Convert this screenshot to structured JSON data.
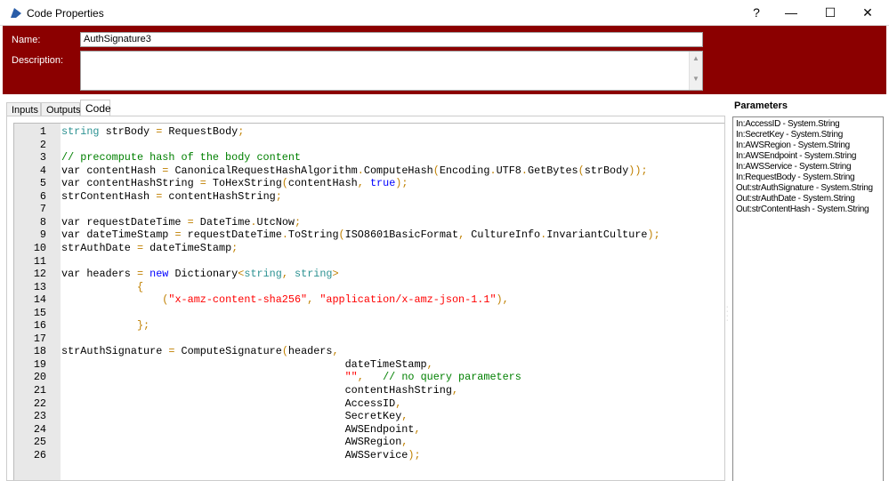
{
  "window": {
    "title": "Code Properties",
    "help": "?",
    "minimize": "—",
    "maximize": "☐",
    "close": "✕"
  },
  "form": {
    "name_label": "Name:",
    "name_value": "AuthSignature3",
    "description_label": "Description:",
    "description_value": ""
  },
  "tabs": [
    {
      "label": "Inputs"
    },
    {
      "label": "Outputs"
    },
    {
      "label": "Code"
    }
  ],
  "code_lines": [
    [
      [
        "type",
        "string"
      ],
      [
        "id",
        " strBody "
      ],
      [
        "op",
        "="
      ],
      [
        "id",
        " RequestBody"
      ],
      [
        "op",
        ";"
      ]
    ],
    [],
    [
      [
        "cm",
        "// precompute hash of the body content"
      ]
    ],
    [
      [
        "id",
        "var contentHash "
      ],
      [
        "op",
        "="
      ],
      [
        "id",
        " CanonicalRequestHashAlgorithm"
      ],
      [
        "op",
        "."
      ],
      [
        "id",
        "ComputeHash"
      ],
      [
        "op",
        "("
      ],
      [
        "id",
        "Encoding"
      ],
      [
        "op",
        "."
      ],
      [
        "id",
        "UTF8"
      ],
      [
        "op",
        "."
      ],
      [
        "id",
        "GetBytes"
      ],
      [
        "op",
        "("
      ],
      [
        "id",
        "strBody"
      ],
      [
        "op",
        "));"
      ]
    ],
    [
      [
        "id",
        "var contentHashString "
      ],
      [
        "op",
        "="
      ],
      [
        "id",
        " ToHexString"
      ],
      [
        "op",
        "("
      ],
      [
        "id",
        "contentHash"
      ],
      [
        "op",
        ","
      ],
      [
        "id",
        " "
      ],
      [
        "kw",
        "true"
      ],
      [
        "op",
        ");"
      ]
    ],
    [
      [
        "id",
        "strContentHash "
      ],
      [
        "op",
        "="
      ],
      [
        "id",
        " contentHashString"
      ],
      [
        "op",
        ";"
      ]
    ],
    [],
    [
      [
        "id",
        "var requestDateTime "
      ],
      [
        "op",
        "="
      ],
      [
        "id",
        " DateTime"
      ],
      [
        "op",
        "."
      ],
      [
        "id",
        "UtcNow"
      ],
      [
        "op",
        ";"
      ]
    ],
    [
      [
        "id",
        "var dateTimeStamp "
      ],
      [
        "op",
        "="
      ],
      [
        "id",
        " requestDateTime"
      ],
      [
        "op",
        "."
      ],
      [
        "id",
        "ToString"
      ],
      [
        "op",
        "("
      ],
      [
        "id",
        "ISO8601BasicFormat"
      ],
      [
        "op",
        ","
      ],
      [
        "id",
        " CultureInfo"
      ],
      [
        "op",
        "."
      ],
      [
        "id",
        "InvariantCulture"
      ],
      [
        "op",
        ");"
      ]
    ],
    [
      [
        "id",
        "strAuthDate "
      ],
      [
        "op",
        "="
      ],
      [
        "id",
        " dateTimeStamp"
      ],
      [
        "op",
        ";"
      ]
    ],
    [],
    [
      [
        "id",
        "var headers "
      ],
      [
        "op",
        "="
      ],
      [
        "id",
        " "
      ],
      [
        "kw",
        "new"
      ],
      [
        "id",
        " Dictionary"
      ],
      [
        "op",
        "<"
      ],
      [
        "type",
        "string"
      ],
      [
        "op",
        ","
      ],
      [
        "id",
        " "
      ],
      [
        "type",
        "string"
      ],
      [
        "op",
        ">"
      ]
    ],
    [
      [
        "id",
        "            "
      ],
      [
        "op",
        "{"
      ]
    ],
    [
      [
        "id",
        "                "
      ],
      [
        "op",
        "("
      ],
      [
        "str",
        "\"x-amz-content-sha256\""
      ],
      [
        "op",
        ","
      ],
      [
        "id",
        " "
      ],
      [
        "str",
        "\"application/x-amz-json-1.1\""
      ],
      [
        "op",
        "),"
      ]
    ],
    [],
    [
      [
        "id",
        "            "
      ],
      [
        "op",
        "};"
      ]
    ],
    [],
    [
      [
        "id",
        "strAuthSignature "
      ],
      [
        "op",
        "="
      ],
      [
        "id",
        " ComputeSignature"
      ],
      [
        "op",
        "("
      ],
      [
        "id",
        "headers"
      ],
      [
        "op",
        ","
      ]
    ],
    [
      [
        "id",
        "                                             dateTimeStamp"
      ],
      [
        "op",
        ","
      ]
    ],
    [
      [
        "id",
        "                                             "
      ],
      [
        "str",
        "\"\""
      ],
      [
        "op",
        ","
      ],
      [
        "id",
        "   "
      ],
      [
        "cm",
        "// no query parameters"
      ]
    ],
    [
      [
        "id",
        "                                             contentHashString"
      ],
      [
        "op",
        ","
      ]
    ],
    [
      [
        "id",
        "                                             AccessID"
      ],
      [
        "op",
        ","
      ]
    ],
    [
      [
        "id",
        "                                             SecretKey"
      ],
      [
        "op",
        ","
      ]
    ],
    [
      [
        "id",
        "                                             AWSEndpoint"
      ],
      [
        "op",
        ","
      ]
    ],
    [
      [
        "id",
        "                                             AWSRegion"
      ],
      [
        "op",
        ","
      ]
    ],
    [
      [
        "id",
        "                                             AWSService"
      ],
      [
        "op",
        ");"
      ]
    ]
  ],
  "parameters": {
    "title": "Parameters",
    "items": [
      "In:AccessID - System.String",
      "In:SecretKey - System.String",
      "In:AWSRegion - System.String",
      "In:AWSEndpoint - System.String",
      "In:AWSService - System.String",
      "In:RequestBody - System.String",
      "Out:strAuthSignature - System.String",
      "Out:strAuthDate - System.String",
      "Out:strContentHash - System.String"
    ]
  },
  "colors": {
    "header": "#8b0000"
  }
}
